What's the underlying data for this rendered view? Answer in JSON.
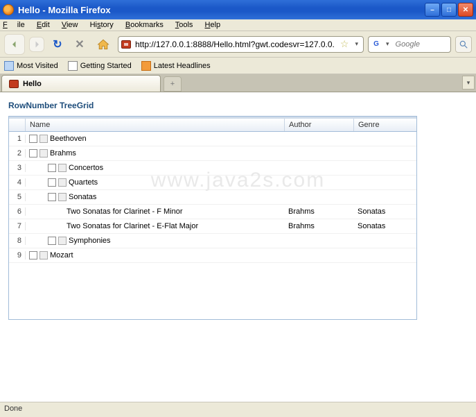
{
  "window": {
    "title": "Hello - Mozilla Firefox"
  },
  "menu": {
    "file": "File",
    "edit": "Edit",
    "view": "View",
    "history": "History",
    "bookmarks": "Bookmarks",
    "tools": "Tools",
    "help": "Help"
  },
  "nav": {
    "url": "http://127.0.0.1:8888/Hello.html?gwt.codesvr=127.0.0.",
    "search_placeholder": "Google"
  },
  "bookmarks": {
    "most_visited": "Most Visited",
    "getting_started": "Getting Started",
    "latest_headlines": "Latest Headlines"
  },
  "tab": {
    "active_label": "Hello",
    "new_label": "+"
  },
  "page": {
    "heading": "RowNumber TreeGrid",
    "columns": {
      "name": "Name",
      "author": "Author",
      "genre": "Genre"
    },
    "rows": [
      {
        "n": "1",
        "indent": 0,
        "toggle": true,
        "icon": true,
        "name": "Beethoven",
        "author": "",
        "genre": ""
      },
      {
        "n": "2",
        "indent": 0,
        "toggle": true,
        "icon": true,
        "name": "Brahms",
        "author": "",
        "genre": ""
      },
      {
        "n": "3",
        "indent": 1,
        "toggle": true,
        "icon": true,
        "name": "Concertos",
        "author": "",
        "genre": ""
      },
      {
        "n": "4",
        "indent": 1,
        "toggle": true,
        "icon": true,
        "name": "Quartets",
        "author": "",
        "genre": ""
      },
      {
        "n": "5",
        "indent": 1,
        "toggle": true,
        "icon": true,
        "name": "Sonatas",
        "author": "",
        "genre": ""
      },
      {
        "n": "6",
        "indent": 2,
        "toggle": false,
        "icon": false,
        "name": "Two Sonatas for Clarinet - F Minor",
        "author": "Brahms",
        "genre": "Sonatas"
      },
      {
        "n": "7",
        "indent": 2,
        "toggle": false,
        "icon": false,
        "name": "Two Sonatas for Clarinet - E-Flat Major",
        "author": "Brahms",
        "genre": "Sonatas"
      },
      {
        "n": "8",
        "indent": 1,
        "toggle": true,
        "icon": true,
        "name": "Symphonies",
        "author": "",
        "genre": ""
      },
      {
        "n": "9",
        "indent": 0,
        "toggle": true,
        "icon": true,
        "name": "Mozart",
        "author": "",
        "genre": ""
      }
    ]
  },
  "watermark": "www.java2s.com",
  "status": {
    "text": "Done"
  }
}
